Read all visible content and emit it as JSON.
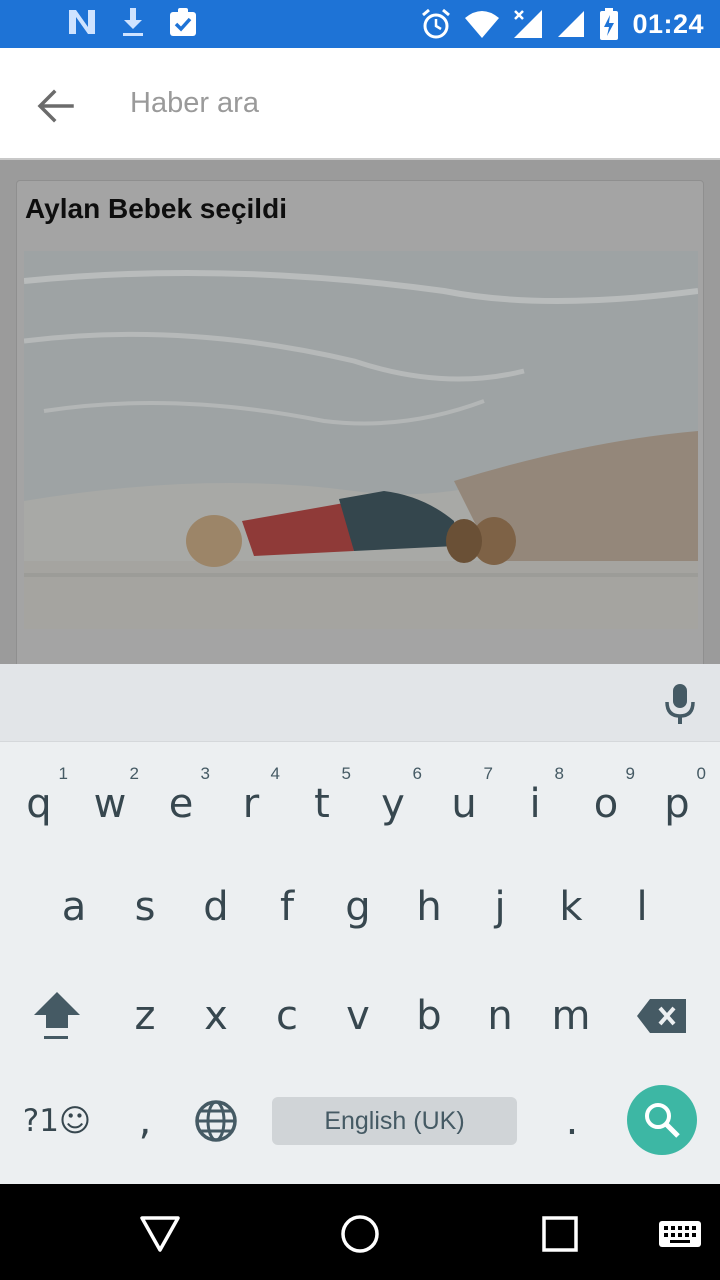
{
  "status_bar": {
    "time": "01:24",
    "icons_left": [
      "n-notification-icon",
      "download-icon",
      "clipboard-check-icon"
    ],
    "icons_right": [
      "alarm-icon",
      "wifi-icon",
      "signal-no-data-icon",
      "signal-icon",
      "battery-charging-icon"
    ],
    "background": "#1e73d6"
  },
  "search": {
    "placeholder": "Haber ara",
    "value": ""
  },
  "card": {
    "title": "Aylan Bebek seçildi"
  },
  "keyboard": {
    "row1": [
      {
        "key": "q",
        "hint": "1"
      },
      {
        "key": "w",
        "hint": "2"
      },
      {
        "key": "e",
        "hint": "3"
      },
      {
        "key": "r",
        "hint": "4"
      },
      {
        "key": "t",
        "hint": "5"
      },
      {
        "key": "y",
        "hint": "6"
      },
      {
        "key": "u",
        "hint": "7"
      },
      {
        "key": "i",
        "hint": "8"
      },
      {
        "key": "o",
        "hint": "9"
      },
      {
        "key": "p",
        "hint": "0"
      }
    ],
    "row2": [
      "a",
      "s",
      "d",
      "f",
      "g",
      "h",
      "j",
      "k",
      "l"
    ],
    "row3": [
      "z",
      "x",
      "c",
      "v",
      "b",
      "n",
      "m"
    ],
    "symbols_label": "?1☺",
    "comma": ",",
    "period": ".",
    "space_label": "English (UK)",
    "accent": "#3db7a4"
  }
}
